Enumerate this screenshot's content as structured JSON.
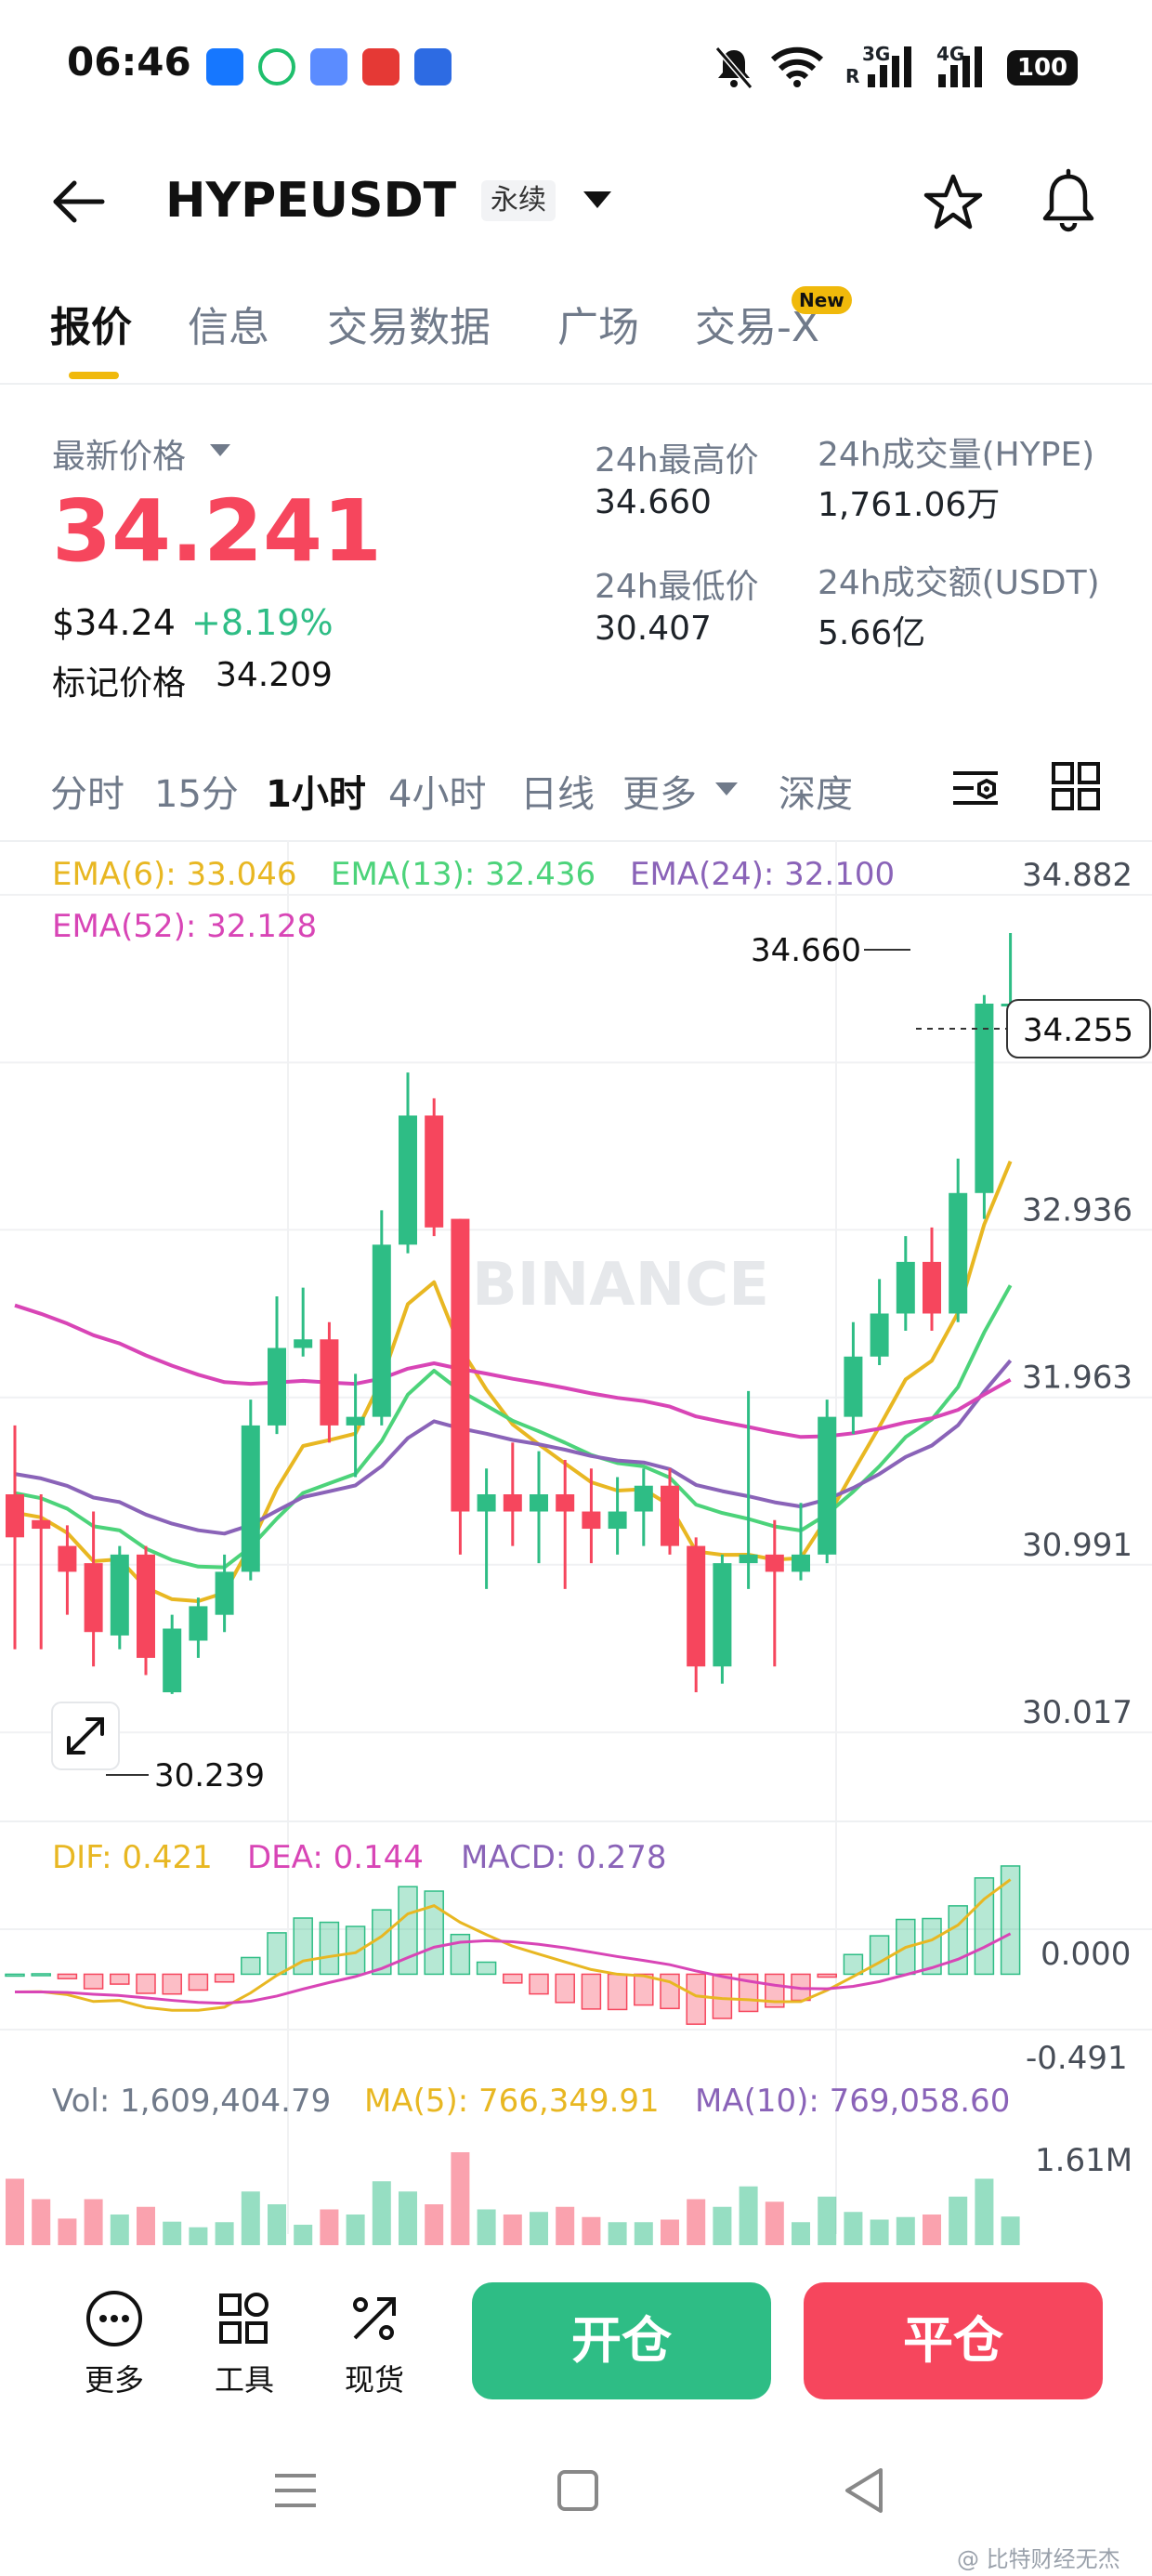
{
  "status_bar": {
    "time": "06:46",
    "network1": "3G",
    "network1_sub": "R",
    "network2": "4G",
    "battery": "100"
  },
  "header": {
    "symbol": "HYPEUSDT",
    "contract_type": "永续"
  },
  "tabs": [
    {
      "label": "报价",
      "active": true
    },
    {
      "label": "信息",
      "active": false
    },
    {
      "label": "交易数据",
      "active": false
    },
    {
      "label": "广场",
      "active": false
    },
    {
      "label": "交易-X",
      "active": false,
      "badge": "New"
    }
  ],
  "price": {
    "last_label": "最新价格",
    "last": "34.241",
    "usd": "$34.24",
    "change_pct": "+8.19%",
    "mark_label": "标记价格",
    "mark": "34.209"
  },
  "stats": {
    "high_label": "24h最高价",
    "high": "34.660",
    "low_label": "24h最低价",
    "low": "30.407",
    "vol_label": "24h成交量(HYPE)",
    "vol": "1,761.06万",
    "turnover_label": "24h成交额(USDT)",
    "turnover": "5.66亿"
  },
  "intervals": [
    {
      "label": "分时",
      "active": false
    },
    {
      "label": "15分",
      "active": false
    },
    {
      "label": "1小时",
      "active": true
    },
    {
      "label": "4小时",
      "active": false
    },
    {
      "label": "日线",
      "active": false
    },
    {
      "label": "更多",
      "active": false
    },
    {
      "label": "深度",
      "active": false
    }
  ],
  "colors": {
    "up": "#2ebd85",
    "down": "#f6465d",
    "ema6": "#e8b722",
    "ema13": "#4cd37a",
    "ema24": "#8a63b8",
    "ema52": "#d845b6",
    "accent": "#f0b90b"
  },
  "chart_data": {
    "type": "candlestick",
    "watermark": "BINANCE",
    "price_axis": {
      "ticks": [
        34.882,
        33.908,
        32.936,
        31.963,
        30.991,
        30.017
      ],
      "ylim": [
        29.5,
        35.2
      ]
    },
    "ema_legend": {
      "ema6": "EMA(6): 33.046",
      "ema13": "EMA(13): 32.436",
      "ema24": "EMA(24): 32.100",
      "ema52": "EMA(52): 32.128"
    },
    "current_price_tag": "34.255",
    "high_marker": "34.660",
    "low_marker": "30.239",
    "candles": [
      {
        "o": 31.4,
        "h": 31.8,
        "l": 30.5,
        "c": 31.15
      },
      {
        "o": 31.25,
        "h": 31.4,
        "l": 30.5,
        "c": 31.2
      },
      {
        "o": 31.1,
        "h": 31.22,
        "l": 30.7,
        "c": 30.95
      },
      {
        "o": 31.0,
        "h": 31.3,
        "l": 30.4,
        "c": 30.6
      },
      {
        "o": 30.58,
        "h": 31.1,
        "l": 30.5,
        "c": 31.05
      },
      {
        "o": 31.05,
        "h": 31.1,
        "l": 30.35,
        "c": 30.45
      },
      {
        "o": 30.25,
        "h": 30.7,
        "l": 30.24,
        "c": 30.62
      },
      {
        "o": 30.55,
        "h": 30.8,
        "l": 30.45,
        "c": 30.75
      },
      {
        "o": 30.7,
        "h": 31.05,
        "l": 30.6,
        "c": 30.95
      },
      {
        "o": 30.95,
        "h": 31.95,
        "l": 30.9,
        "c": 31.8
      },
      {
        "o": 31.8,
        "h": 32.55,
        "l": 31.75,
        "c": 32.25
      },
      {
        "o": 32.25,
        "h": 32.6,
        "l": 32.2,
        "c": 32.3
      },
      {
        "o": 32.3,
        "h": 32.4,
        "l": 31.7,
        "c": 31.8
      },
      {
        "o": 31.8,
        "h": 32.1,
        "l": 31.5,
        "c": 31.85
      },
      {
        "o": 31.85,
        "h": 33.05,
        "l": 31.8,
        "c": 32.85
      },
      {
        "o": 32.85,
        "h": 33.85,
        "l": 32.8,
        "c": 33.6
      },
      {
        "o": 33.6,
        "h": 33.7,
        "l": 32.9,
        "c": 32.95
      },
      {
        "o": 33.0,
        "h": 33.0,
        "l": 31.05,
        "c": 31.3
      },
      {
        "o": 31.3,
        "h": 31.55,
        "l": 30.85,
        "c": 31.4
      },
      {
        "o": 31.4,
        "h": 31.7,
        "l": 31.1,
        "c": 31.3
      },
      {
        "o": 31.3,
        "h": 31.65,
        "l": 31.0,
        "c": 31.4
      },
      {
        "o": 31.4,
        "h": 31.6,
        "l": 30.85,
        "c": 31.3
      },
      {
        "o": 31.3,
        "h": 31.55,
        "l": 31.0,
        "c": 31.2
      },
      {
        "o": 31.2,
        "h": 31.5,
        "l": 31.05,
        "c": 31.3
      },
      {
        "o": 31.3,
        "h": 31.55,
        "l": 31.1,
        "c": 31.45
      },
      {
        "o": 31.45,
        "h": 31.55,
        "l": 31.05,
        "c": 31.1
      },
      {
        "o": 31.1,
        "h": 31.15,
        "l": 30.25,
        "c": 30.4
      },
      {
        "o": 30.4,
        "h": 31.05,
        "l": 30.3,
        "c": 31.0
      },
      {
        "o": 31.0,
        "h": 32.0,
        "l": 30.85,
        "c": 31.05
      },
      {
        "o": 31.05,
        "h": 31.25,
        "l": 30.4,
        "c": 30.95
      },
      {
        "o": 30.95,
        "h": 31.35,
        "l": 30.9,
        "c": 31.05
      },
      {
        "o": 31.05,
        "h": 31.95,
        "l": 31.0,
        "c": 31.85
      },
      {
        "o": 31.85,
        "h": 32.4,
        "l": 31.75,
        "c": 32.2
      },
      {
        "o": 32.2,
        "h": 32.65,
        "l": 32.15,
        "c": 32.45
      },
      {
        "o": 32.45,
        "h": 32.9,
        "l": 32.35,
        "c": 32.75
      },
      {
        "o": 32.75,
        "h": 32.95,
        "l": 32.35,
        "c": 32.45
      },
      {
        "o": 32.45,
        "h": 33.35,
        "l": 32.4,
        "c": 33.15
      },
      {
        "o": 33.15,
        "h": 34.3,
        "l": 33.0,
        "c": 34.25
      },
      {
        "o": 34.25,
        "h": 34.66,
        "l": 34.1,
        "c": 34.25
      }
    ],
    "macd": {
      "legend": {
        "dif": "DIF: 0.421",
        "dea": "DEA: 0.144",
        "macd": "MACD: 0.278"
      },
      "ticks": [
        "0.000",
        "-0.491"
      ],
      "ylim": [
        -0.6,
        0.55
      ]
    },
    "volume": {
      "legend": {
        "vol": "Vol: 1,609,404.79",
        "ma5": "MA(5): 766,349.91",
        "ma10": "MA(10): 769,058.60"
      },
      "tick": "1.61M"
    }
  },
  "bottom_bar": {
    "more": "更多",
    "tools": "工具",
    "spot": "现货",
    "open": "开仓",
    "close": "平仓"
  },
  "watermark_text": "@ 比特财经无杰"
}
